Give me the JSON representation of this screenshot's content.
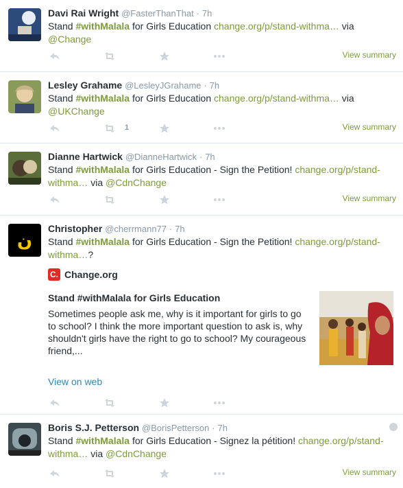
{
  "colors": {
    "accent": "#7d9b3a",
    "muted": "#8899a6",
    "link_blue": "#2a8ab8",
    "change_red": "#e02b26"
  },
  "tweets": [
    {
      "fullname": "Davi Rai Wright",
      "handle": "@FasterThanThat",
      "time": "7h",
      "text": {
        "pre": "Stand ",
        "hashtag": "#withMalala",
        "mid": " for Girls Education ",
        "link": "change.org/p/stand-withma…",
        "post": "  via",
        "mention": "@Change"
      },
      "retweet_count": "",
      "view_summary": "View summary"
    },
    {
      "fullname": "Lesley Grahame",
      "handle": "@LesleyJGrahame",
      "time": "7h",
      "text": {
        "pre": "Stand ",
        "hashtag": "#withMalala",
        "mid": " for Girls Education ",
        "link": "change.org/p/stand-withma…",
        "post": "  via",
        "mention": "@UKChange"
      },
      "retweet_count": "1",
      "view_summary": "View summary"
    },
    {
      "fullname": "Dianne Hartwick",
      "handle": "@DianneHartwick",
      "time": "7h",
      "text": {
        "pre": "Stand ",
        "hashtag": "#withMalala",
        "mid": " for Girls Education - Sign the Petition! ",
        "link1": "change.org/p/stand-",
        "link2": "withma…",
        "post": " via ",
        "mention": "@CdnChange"
      },
      "retweet_count": "",
      "view_summary": "View summary"
    },
    {
      "fullname": "Christopher",
      "handle": "@cherrmann77",
      "time": "7h",
      "text": {
        "pre": "Stand ",
        "hashtag": "#withMalala",
        "mid": " for Girls Education - Sign the Petition! ",
        "link1": "change.org/p/stand-",
        "link2": "withma…",
        "post": "?"
      },
      "card": {
        "source_logo": "C.",
        "source_name": "Change.org",
        "title": "Stand #withMalala for Girls Education",
        "description": "Sometimes people ask me, why is it important for girls to go to school? I think the more important question to ask is, why shouldn't girls have the right to go to school? My courageous friend,...",
        "view_on_web": "View on web"
      }
    },
    {
      "fullname": "Boris S.J. Petterson",
      "handle": "@BorisPetterson",
      "time": "7h",
      "text": {
        "pre": "Stand ",
        "hashtag": "#withMalala",
        "mid": " for Girls Education - Signez la pétition! ",
        "link1": "change.org/p/stand-",
        "link2": "withma…",
        "post": " via ",
        "mention": "@CdnChange"
      },
      "retweet_count": "",
      "view_summary": "View summary"
    }
  ]
}
